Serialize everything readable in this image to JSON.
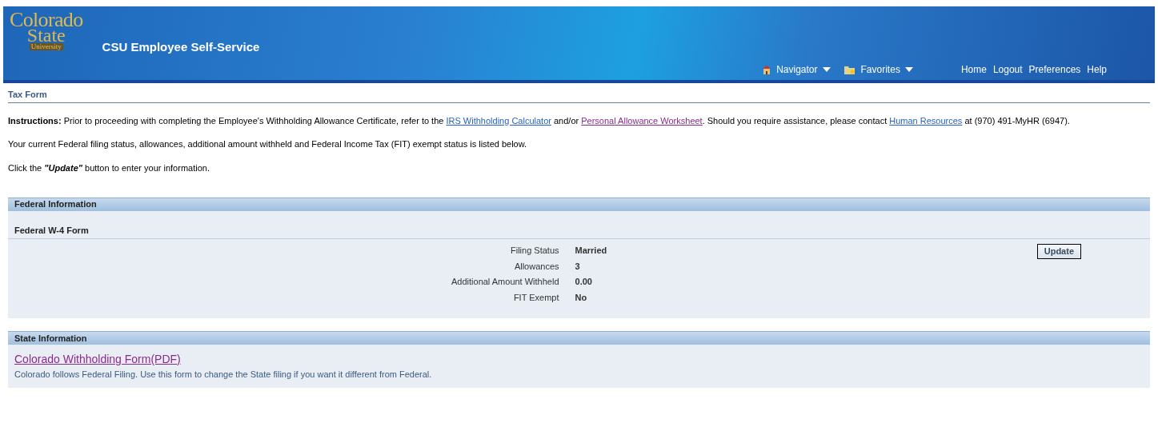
{
  "header": {
    "logo": [
      "Colorado",
      "State",
      "University"
    ],
    "title": "CSU Employee Self-Service",
    "menus": [
      {
        "kind": "home",
        "label": "Navigator"
      },
      {
        "kind": "folder",
        "label": "Favorites"
      }
    ],
    "links": [
      "Home",
      "Logout",
      "Preferences",
      "Help"
    ]
  },
  "page_title": "Tax Form",
  "instructions": [
    {
      "kind": "bold",
      "text": "Instructions:"
    },
    {
      "kind": "text",
      "text": " Prior to proceeding with completing the Employee's Withholding Allowance Certificate, refer to the "
    },
    {
      "kind": "link",
      "text": "IRS Withholding Calculator",
      "visited": false
    },
    {
      "kind": "text",
      "text": " and/or "
    },
    {
      "kind": "link",
      "text": "Personal Allowance Worksheet",
      "visited": true
    },
    {
      "kind": "text",
      "text": ". Should you require assistance, please contact "
    },
    {
      "kind": "link",
      "text": "Human Resources",
      "visited": false
    },
    {
      "kind": "text",
      "text": " at (970) 491-MyHR (6947)."
    }
  ],
  "status_note": "Your current Federal filing status, allowances, additional amount withheld and Federal Income Tax (FIT) exempt status is listed below.",
  "click_note": "Click the **\"Update\"** button to enter your information.",
  "federal": {
    "heading": "Federal Information",
    "subheading": "Federal W-4 Form",
    "fields": [
      {
        "label": "Filing Status",
        "value": "Married"
      },
      {
        "label": "Allowances",
        "value": "3"
      },
      {
        "label": "Additional Amount Withheld",
        "value": "0.00"
      },
      {
        "label": "FIT Exempt",
        "value": "No"
      }
    ],
    "button": "Update"
  },
  "state": {
    "heading": "State Information",
    "link": {
      "text": "Colorado Withholding Form(PDF)",
      "visited": true
    },
    "note": "Colorado follows Federal Filing. Use this form to change the State filing if you want it different from Federal."
  }
}
